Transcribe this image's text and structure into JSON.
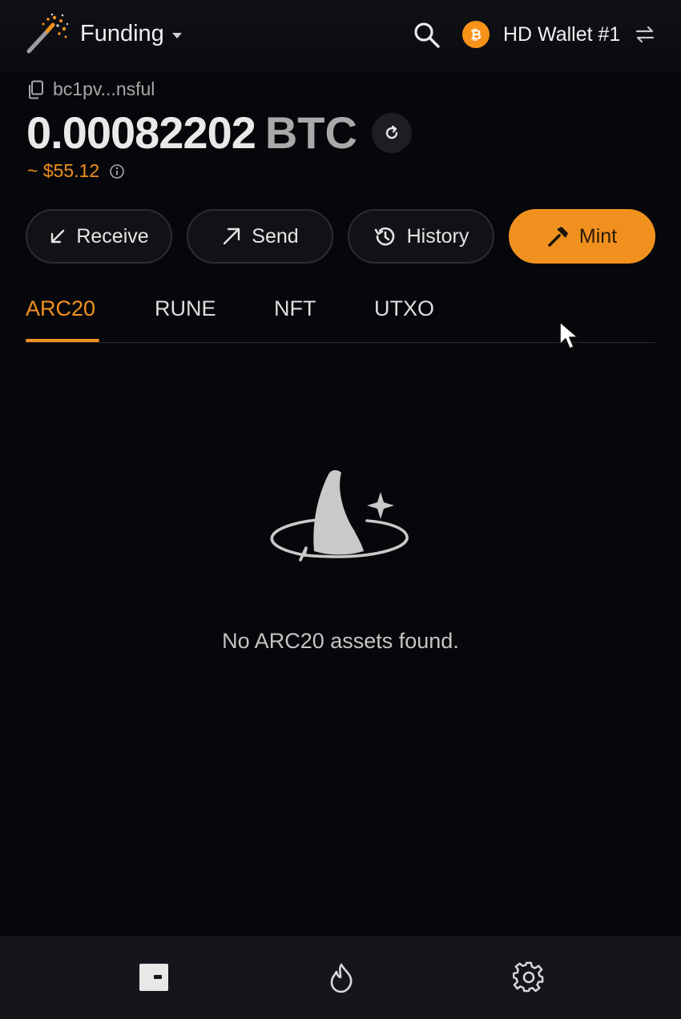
{
  "header": {
    "account_name": "Funding",
    "wallet_name": "HD Wallet #1",
    "icons": [
      "wand-logo-icon",
      "chevron-down-icon",
      "search-icon",
      "bitcoin-icon",
      "switch-icon"
    ]
  },
  "balance": {
    "address": "bc1pv...nsful",
    "amount": "0.00082202",
    "unit": "BTC",
    "usd": "~ $55.12"
  },
  "actions": {
    "receive": "Receive",
    "send": "Send",
    "history": "History",
    "mint": "Mint"
  },
  "tabs": {
    "items": [
      "ARC20",
      "RUNE",
      "NFT",
      "UTXO"
    ],
    "active": "ARC20"
  },
  "empty_state": {
    "message": "No ARC20 assets found.",
    "icon": "witch-hat-icon"
  },
  "bottom_nav": {
    "items": [
      "wallet-icon",
      "flame-icon",
      "gear-icon"
    ]
  },
  "colors": {
    "accent": "#f0911f",
    "background": "#06070a",
    "bitcoin": "#f7931a"
  }
}
